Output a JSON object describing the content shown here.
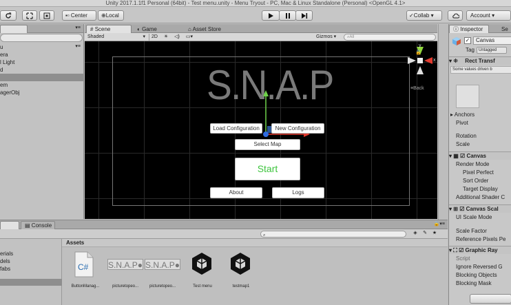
{
  "window": {
    "title": "Unity 2017.1.1f1 Personal (64bit) - Test menu.unity - Menu Tryout - PC, Mac & Linux Standalone (Personal) <OpenGL 4.1>"
  },
  "toolbar": {
    "center_label": "Center",
    "local_label": "Local",
    "collab_label": "Collab",
    "account_label": "Account"
  },
  "hierarchy": {
    "items": [
      "u",
      "era",
      "l Light",
      "d",
      "",
      "em",
      "agerObj"
    ]
  },
  "scene": {
    "tabs": [
      "Scene",
      "Game",
      "Asset Store"
    ],
    "shading_mode": "Shaded",
    "mode_2d": "2D",
    "gizmos_label": "Gizmos",
    "search_placeholder": "All",
    "logo_text": "S.N.A.P",
    "back_label": "Back",
    "buttons": {
      "load_config": "Load Configuration",
      "new_config": "New Configuration",
      "select_map": "Select Map",
      "start": "Start",
      "about": "About",
      "logs": "Logs"
    },
    "axis_labels": {
      "y": "y",
      "x": "x"
    }
  },
  "inspector": {
    "tabs": [
      "Inspector",
      "Se"
    ],
    "object_name": "Canvas",
    "tag_label": "Tag",
    "tag_value": "Untagged",
    "rect_transform_title": "Rect Transf",
    "rect_transform_note": "Some values driven b",
    "labels": {
      "anchors": "Anchors",
      "pivot": "Pivot",
      "rotation": "Rotation",
      "scale": "Scale"
    },
    "canvas_component": {
      "title": "Canvas",
      "render_mode": "Render Mode",
      "pixel_perfect": "Pixel Perfect",
      "sort_order": "Sort Order",
      "target_display": "Target Display",
      "additional_shader": "Additional Shader C"
    },
    "canvas_scaler": {
      "title": "Canvas Scal",
      "ui_scale_mode": "UI Scale Mode",
      "scale_factor": "Scale Factor",
      "reference_pixels": "Reference Pixels Pe"
    },
    "graphic_raycaster": {
      "title": "Graphic Ray",
      "script": "Script",
      "ignore_reversed": "Ignore Reversed G",
      "blocking_objects": "Blocking Objects",
      "blocking_mask": "Blocking Mask"
    }
  },
  "project": {
    "tabs": [
      "",
      "Console"
    ],
    "left_items": [
      "erials",
      "dels",
      "fabs"
    ],
    "assets_header": "Assets",
    "assets": [
      {
        "label": "ButtonManag...",
        "icon": "csharp-script-icon"
      },
      {
        "label": "picturetopeo...",
        "icon": "snap-image-icon"
      },
      {
        "label": "picturetopeo...",
        "icon": "snap-image-icon"
      },
      {
        "label": "Test menu",
        "icon": "unity-scene-icon"
      },
      {
        "label": "testmap1",
        "icon": "unity-scene-icon"
      }
    ]
  }
}
